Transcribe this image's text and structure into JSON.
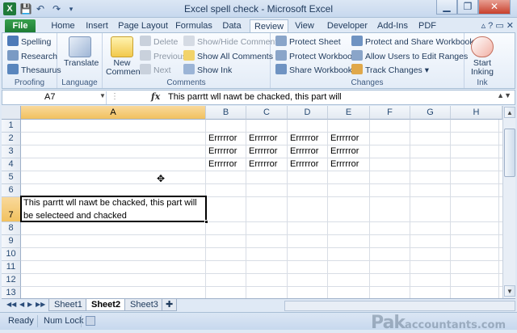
{
  "window": {
    "title": "Excel spell check  -  Microsoft Excel",
    "minimize": "▁",
    "restore": "❐",
    "close": "✕"
  },
  "quick_access": {
    "save": "💾",
    "undo": "↶",
    "redo": "↷",
    "customize": "▾"
  },
  "tabs": [
    "File",
    "Home",
    "Insert",
    "Page Layout",
    "Formulas",
    "Data",
    "Review",
    "View",
    "Developer",
    "Add-Ins",
    "PDF"
  ],
  "active_tab": "Review",
  "tab_icons": "▵ ? ▭ ✕",
  "ribbon": {
    "proofing": {
      "label": "Proofing",
      "spelling": "Spelling",
      "research": "Research",
      "thesaurus": "Thesaurus"
    },
    "language": {
      "label": "Language",
      "translate": "Translate"
    },
    "comments": {
      "label": "Comments",
      "new_comment": "New Comment",
      "delete": "Delete",
      "previous": "Previous",
      "next": "Next",
      "show_hide": "Show/Hide Comment",
      "show_all": "Show All Comments",
      "show_ink": "Show Ink"
    },
    "changes": {
      "label": "Changes",
      "protect_sheet": "Protect Sheet",
      "protect_workbook": "Protect Workbook",
      "share_workbook": "Share Workbook",
      "protect_share": "Protect and Share Workbook",
      "allow_users": "Allow Users to Edit Ranges",
      "track_changes": "Track Changes"
    },
    "ink": {
      "label": "Ink",
      "start_inking": "Start Inking"
    }
  },
  "formula_bar": {
    "name_box": "A7",
    "fx": "fx",
    "formula": "This parrtt wll nawt be chacked, this part will"
  },
  "columns": [
    "A",
    "B",
    "C",
    "D",
    "E",
    "F",
    "G",
    "H"
  ],
  "selected_column": "A",
  "rows": [
    "1",
    "2",
    "3",
    "4",
    "5",
    "6",
    "7",
    "8",
    "9",
    "10",
    "11",
    "12",
    "13"
  ],
  "selected_row": "7",
  "cells": {
    "B2": "Errrrror",
    "C2": "Errrrror",
    "D2": "Errrrror",
    "E2": "Errrrror",
    "B3": "Errrrror",
    "C3": "Errrrror",
    "D3": "Errrrror",
    "E3": "Errrrror",
    "B4": "Errrrror",
    "C4": "Errrrror",
    "D4": "Errrrror",
    "E4": "Errrrror",
    "A7": "This parrtt wll nawt be chacked, this part will be selecteed and chacked"
  },
  "sheet_tabs": [
    "Sheet1",
    "Sheet2",
    "Sheet3"
  ],
  "active_sheet": "Sheet2",
  "status_bar": {
    "ready": "Ready",
    "num_lock": "Num Lock"
  },
  "watermark": {
    "main": "Pak",
    "tail": "accountants.com"
  }
}
